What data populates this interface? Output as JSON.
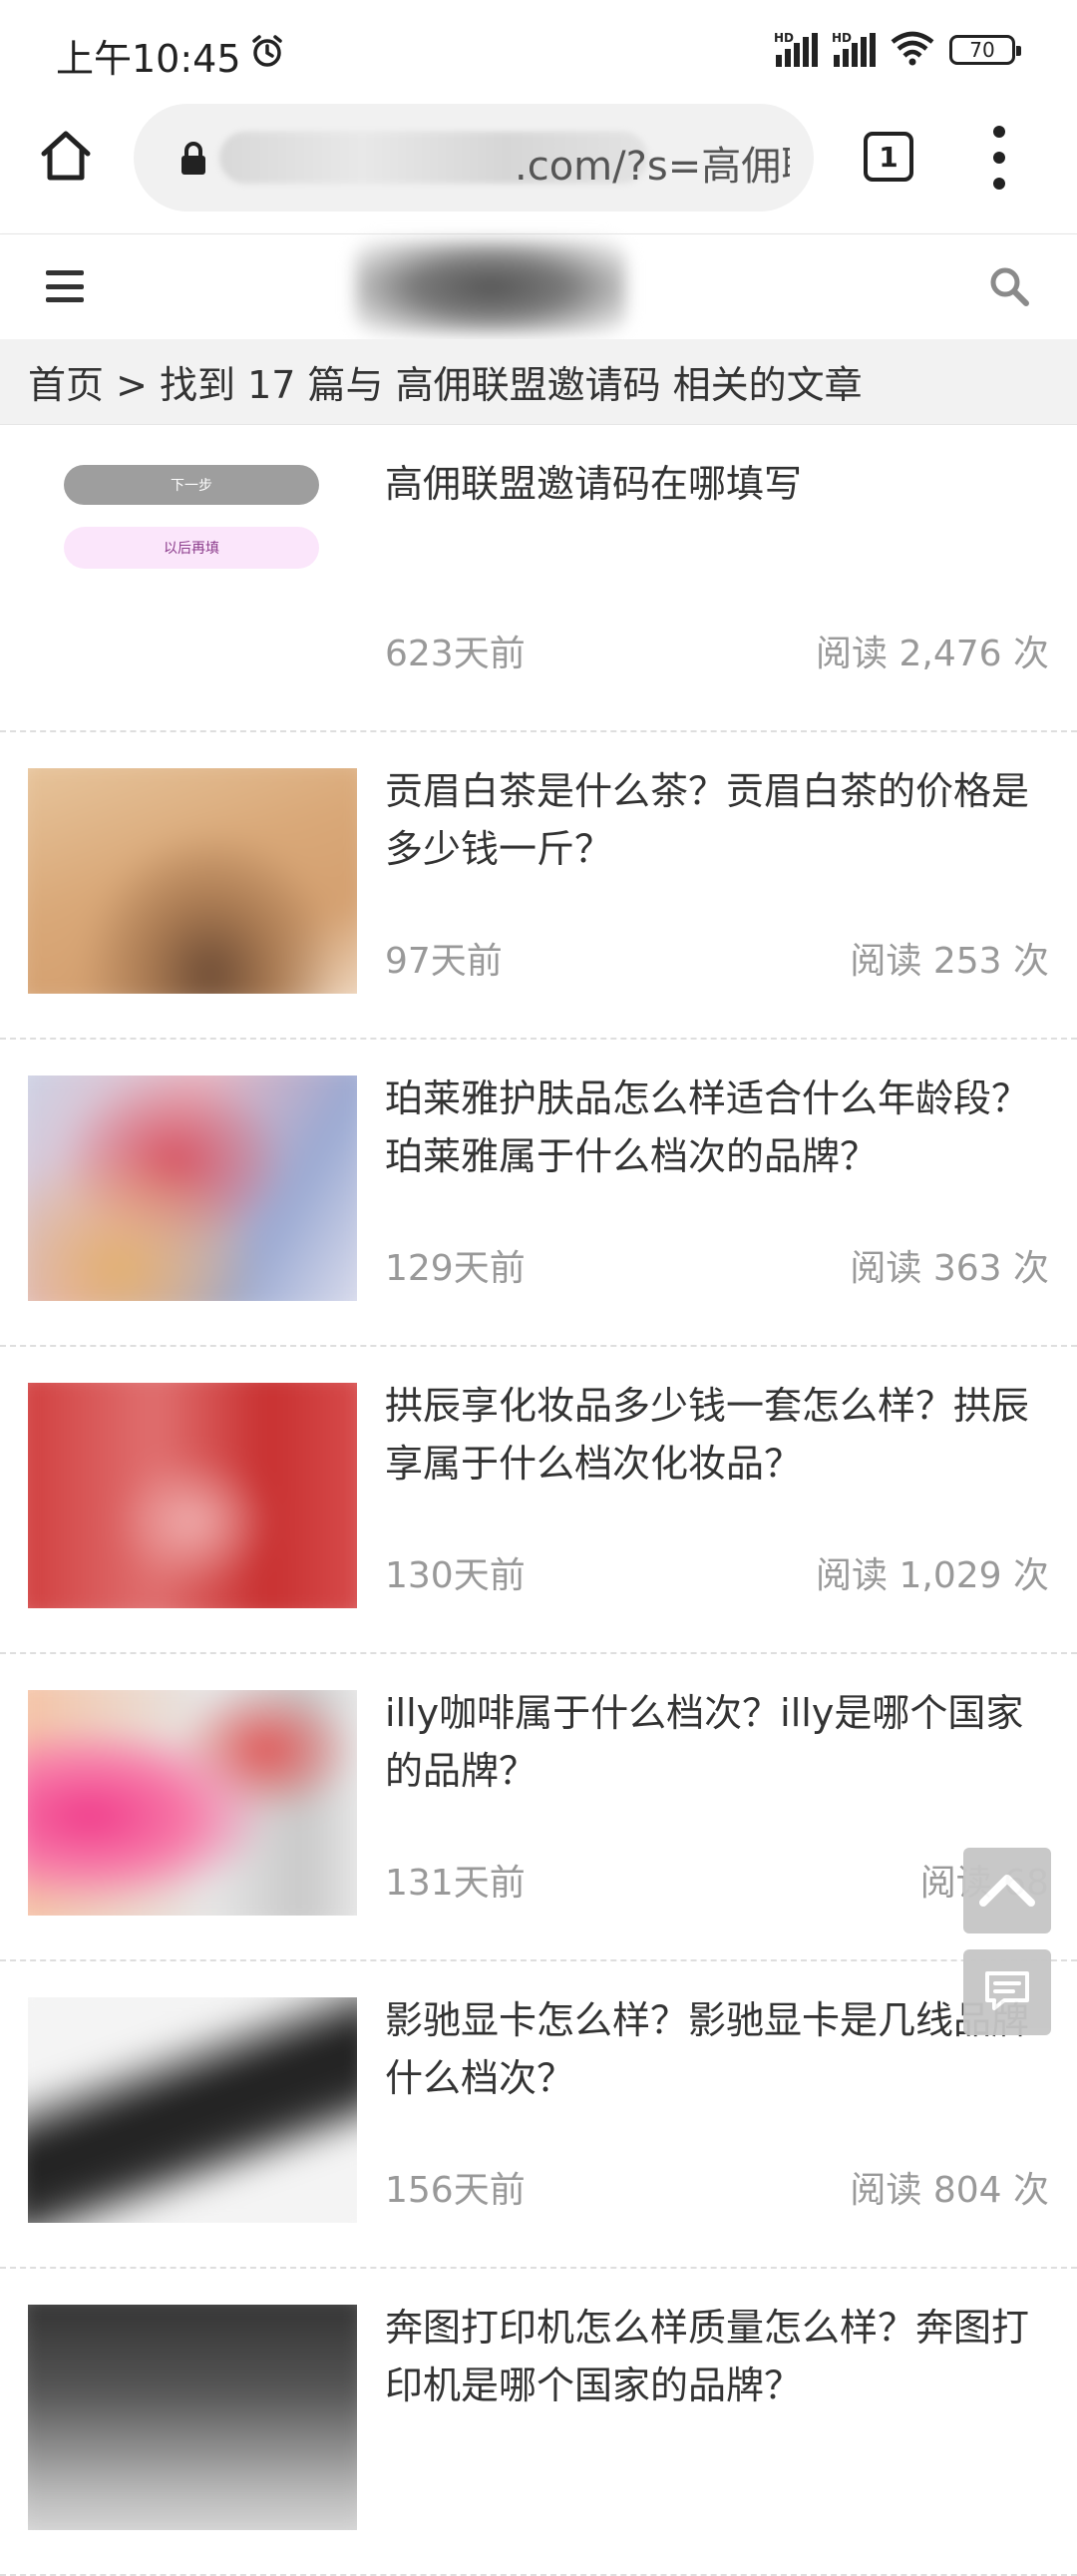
{
  "status_bar": {
    "time": "上午10:45",
    "network1": "HD",
    "network2": "HD",
    "battery": "70"
  },
  "browser": {
    "url_suffix": ".com/?s=高佣联",
    "tab_count": "1"
  },
  "breadcrumb": {
    "text": "首页 > 找到 17 篇与 高佣联盟邀请码 相关的文章"
  },
  "articles": [
    {
      "title": "高佣联盟邀请码在哪填写",
      "date": "623天前",
      "views": "阅读 2,476 次",
      "thumb_next": "下一步",
      "thumb_later": "以后再填"
    },
    {
      "title": "贡眉白茶是什么茶？贡眉白茶的价格是多少钱一斤？",
      "date": "97天前",
      "views": "阅读 253 次"
    },
    {
      "title": "珀莱雅护肤品怎么样适合什么年龄段？珀莱雅属于什么档次的品牌？",
      "date": "129天前",
      "views": "阅读 363 次"
    },
    {
      "title": "拱辰享化妆品多少钱一套怎么样？拱辰享属于什么档次化妆品？",
      "date": "130天前",
      "views": "阅读 1,029 次"
    },
    {
      "title": "illy咖啡属于什么档次？illy是哪个国家的品牌？",
      "date": "131天前",
      "views": "阅读 68"
    },
    {
      "title": "影驰显卡怎么样？影驰显卡是几线品牌什么档次？",
      "date": "156天前",
      "views": "阅读 804 次"
    },
    {
      "title": "奔图打印机怎么样质量怎么样？奔图打印机是哪个国家的品牌？",
      "date": "",
      "views": ""
    }
  ],
  "icons": {
    "home": "home-icon",
    "lock": "lock-icon",
    "search": "search-icon",
    "back_to_top": "chevron-up-icon",
    "comment": "comment-icon"
  }
}
